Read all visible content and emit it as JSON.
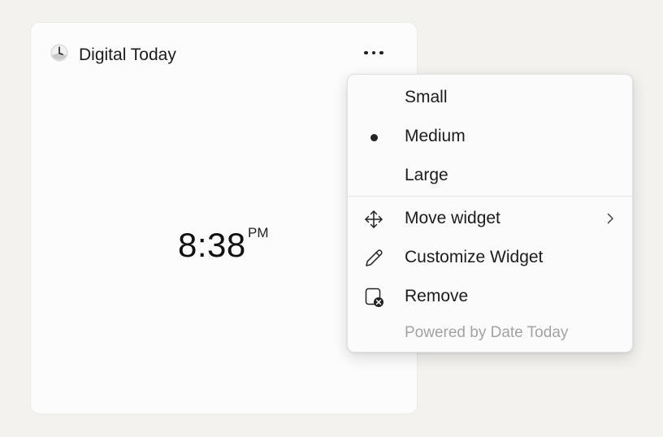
{
  "widget": {
    "title": "Digital Today",
    "app_icon": "clock-icon",
    "more_icon": "more-horizontal-icon",
    "clock": {
      "time": "8:38",
      "ampm": "PM"
    }
  },
  "menu": {
    "size_options": [
      {
        "label": "Small",
        "selected": false
      },
      {
        "label": "Medium",
        "selected": true
      },
      {
        "label": "Large",
        "selected": false
      }
    ],
    "actions": [
      {
        "label": "Move widget",
        "icon": "move-icon",
        "has_submenu": true
      },
      {
        "label": "Customize Widget",
        "icon": "pencil-icon",
        "has_submenu": false
      },
      {
        "label": "Remove",
        "icon": "remove-icon",
        "has_submenu": false
      }
    ],
    "footer": "Powered by Date Today"
  },
  "colors": {
    "background": "#f3f2ef",
    "card": "#fcfcfc",
    "menu": "#fbfbfb",
    "text": "#1c1c1c",
    "muted": "#a3a3a3"
  }
}
